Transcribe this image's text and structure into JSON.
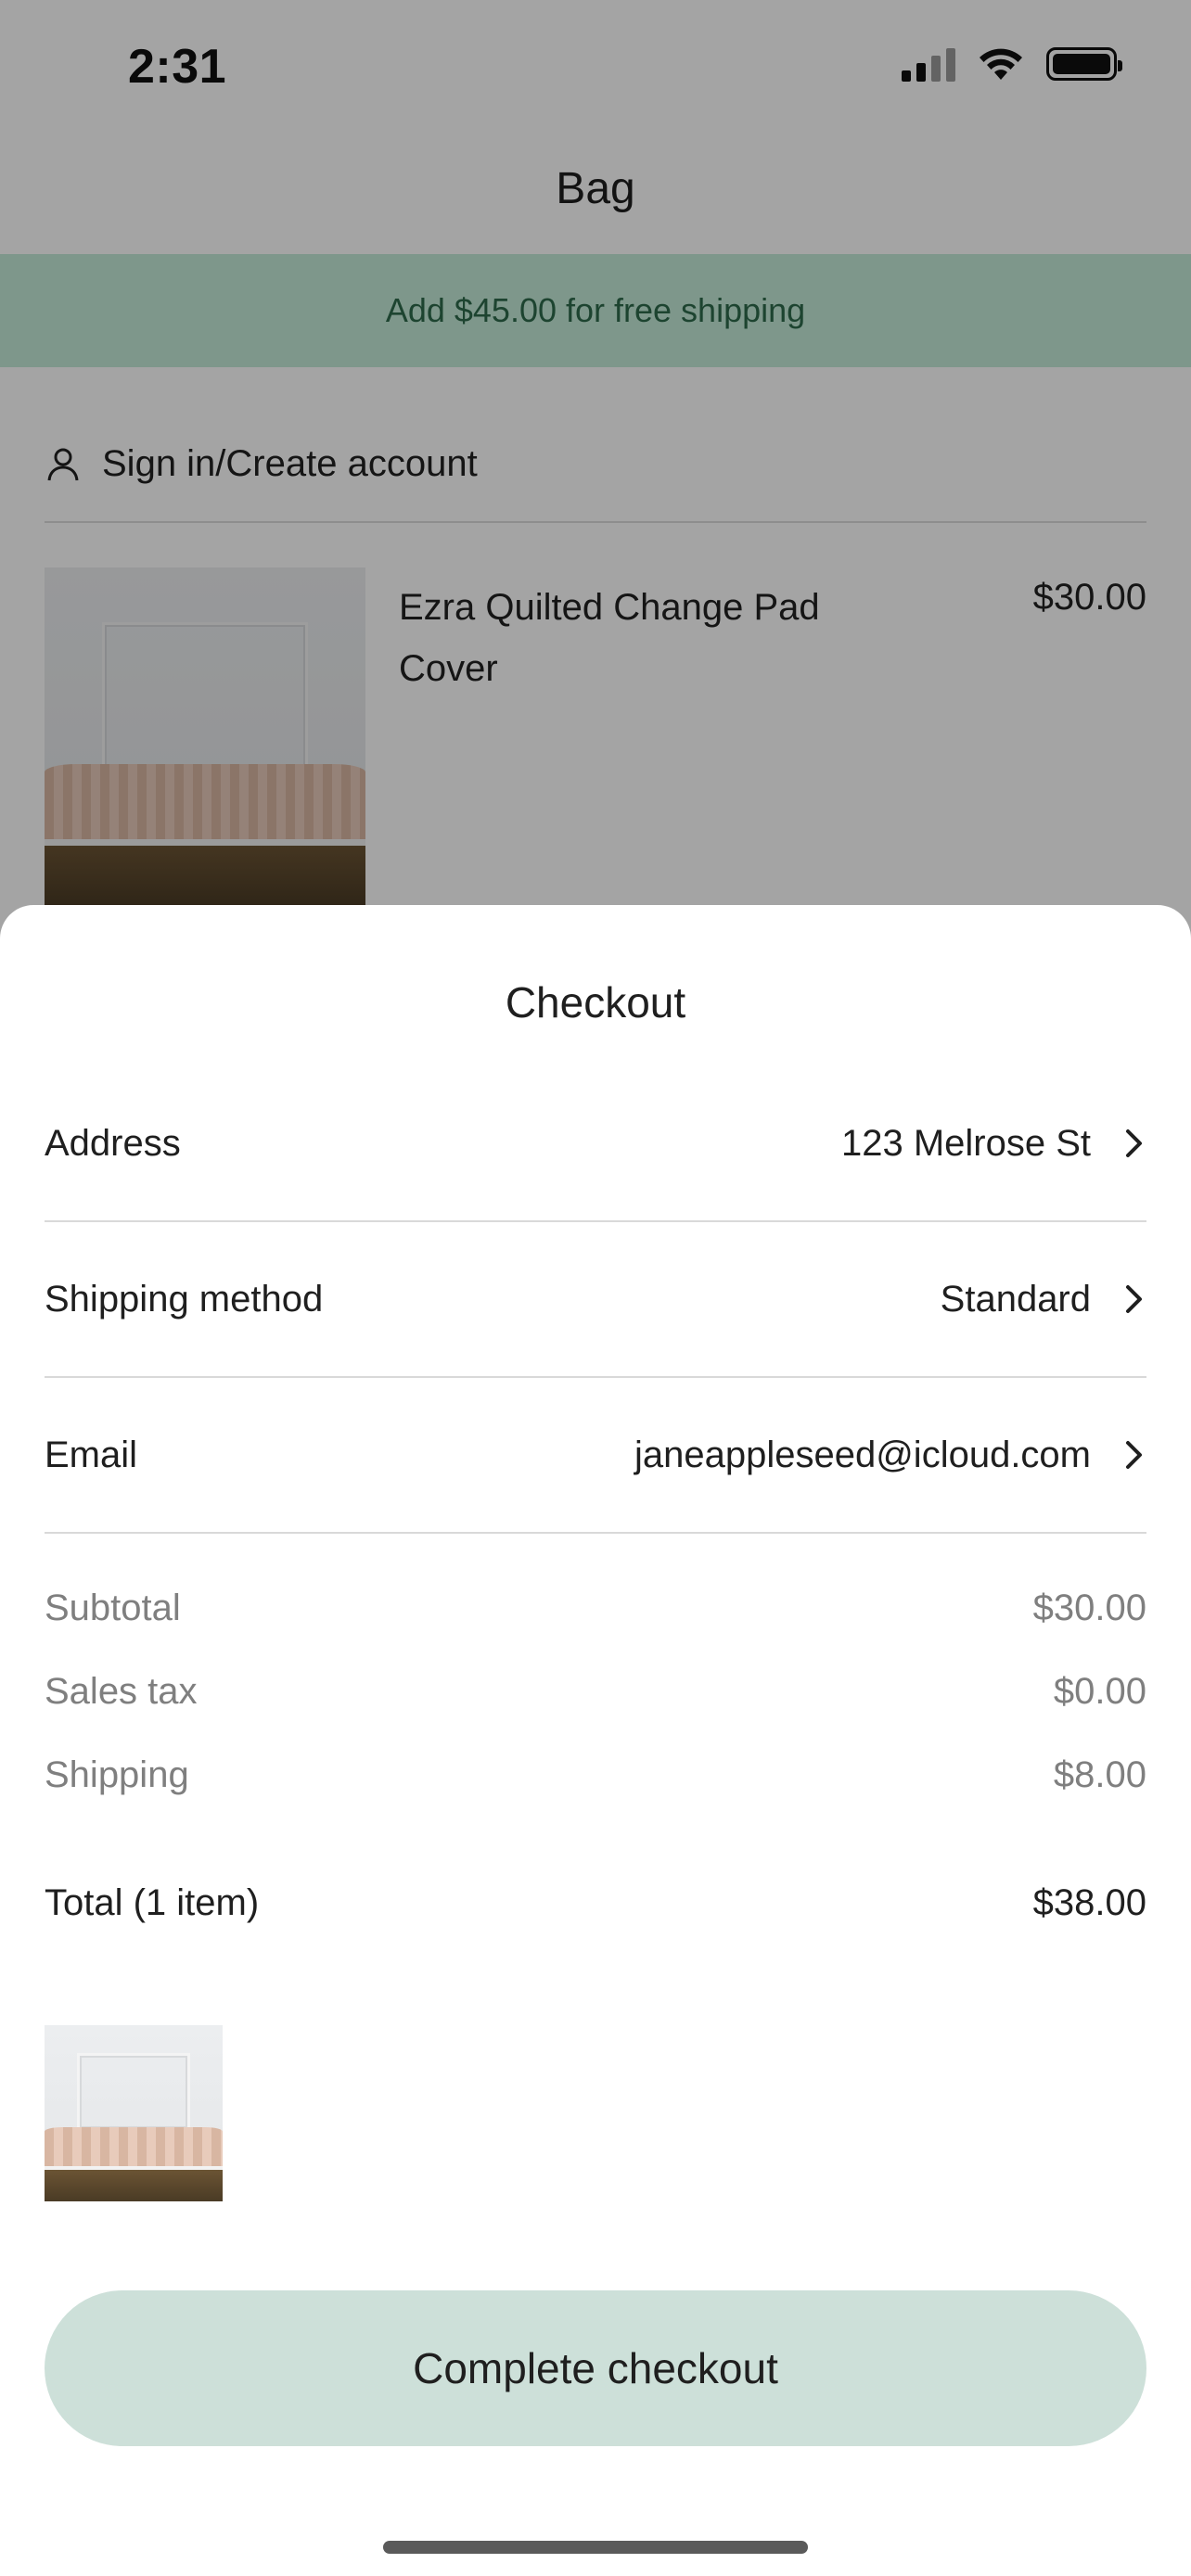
{
  "status_bar": {
    "time": "2:31",
    "signal_icon": "cellular-signal-icon",
    "wifi_icon": "wifi-icon",
    "battery_icon": "battery-icon"
  },
  "background": {
    "title": "Bag",
    "banner": {
      "text": "Add $45.00 for free shipping",
      "color": "#c5ebd9"
    },
    "signin": {
      "icon": "person-icon",
      "label": "Sign in/Create account"
    },
    "item": {
      "name": "Ezra Quilted Change Pad Cover",
      "price": "$30.00"
    }
  },
  "checkout": {
    "title": "Checkout",
    "rows": [
      {
        "label": "Address",
        "value": "123 Melrose St",
        "icon": "chevron-right-icon"
      },
      {
        "label": "Shipping method",
        "value": "Standard",
        "icon": "chevron-right-icon"
      },
      {
        "label": "Email",
        "value": "janeappleseed@icloud.com",
        "icon": "chevron-right-icon"
      }
    ],
    "summary": [
      {
        "label": "Subtotal",
        "value": "$30.00"
      },
      {
        "label": "Sales tax",
        "value": "$0.00"
      },
      {
        "label": "Shipping",
        "value": "$8.00"
      }
    ],
    "total": {
      "label": "Total (1 item)",
      "value": "$38.00"
    },
    "button_label": "Complete checkout",
    "button_color": "#cde0d9"
  }
}
